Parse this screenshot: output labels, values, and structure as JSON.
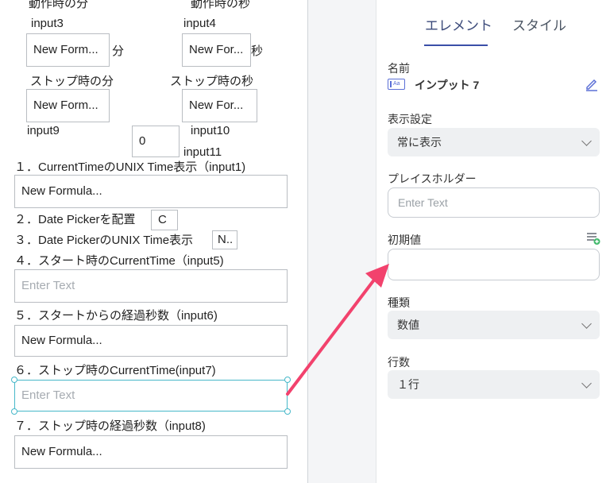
{
  "canvas": {
    "top_labels": {
      "left": "動作時の分",
      "right": "動作時の秒"
    },
    "input3_label": "input3",
    "input4_label": "input4",
    "minute_box": "New Form...",
    "minute_unit": "分",
    "second_box": "New For...",
    "second_unit": "秒",
    "stop_minute_label": "ストップ時の分",
    "stop_second_label": "ストップ時の秒",
    "stop_minute_box": "New Form...",
    "stop_second_box": "New For...",
    "input9_label": "input9",
    "input10_label": "input10",
    "input11_label": "input11",
    "zero_box": "0",
    "line1": "１．CurrentTimeのUNIX Time表示（input1)",
    "formula1": "New Formula...",
    "line2": "２．Date Pickerを配置",
    "c_box": "C",
    "line3": "３．Date PickerのUNIX Time表示",
    "n_box": "N..",
    "line4": "４．スタート時のCurrentTime（input5)",
    "enter_text_1": "Enter Text",
    "line5": "５．スタートからの経過秒数（input6)",
    "formula5": "New Formula...",
    "line6": "６．ストップ時のCurrentTime(input7)",
    "enter_text_2": "Enter Text",
    "line7": "７．ストップ時の経過秒数（input8)",
    "formula7": "New Formula..."
  },
  "panel": {
    "tabs": [
      "エレメント",
      "スタイル"
    ],
    "name_label": "名前",
    "name_value": "インプット 7",
    "visibility_label": "表示設定",
    "visibility_value": "常に表示",
    "placeholder_label": "プレイスホルダー",
    "placeholder_value": "Enter Text",
    "initial_label": "初期値",
    "initial_value": "",
    "type_label": "種類",
    "type_value": "数値",
    "rows_label": "行数",
    "rows_value": "１行"
  },
  "colors": {
    "arrow": "#f2426d",
    "selection": "#47b8c9",
    "tab_accent": "#3a4fa8"
  }
}
